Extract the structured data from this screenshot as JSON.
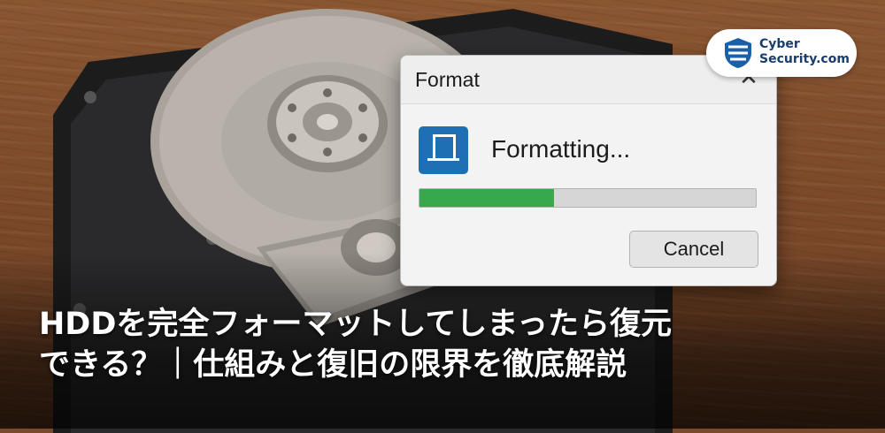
{
  "dialog": {
    "title": "Format",
    "close_glyph": "✕",
    "status": "Formatting...",
    "progress_fraction": 0.4,
    "cancel_label": "Cancel",
    "icon": "drive-monitor-icon",
    "accent": "#1e6fb3",
    "progress_color": "#35a94c"
  },
  "logo": {
    "line1": "Cyber",
    "line2": "Security.com",
    "icon": "shield-stripes-icon"
  },
  "headline": {
    "line1": "HDDを完全フォーマットしてしまったら復元",
    "line2": "できる？｜仕組みと復旧の限界を徹底解説"
  }
}
